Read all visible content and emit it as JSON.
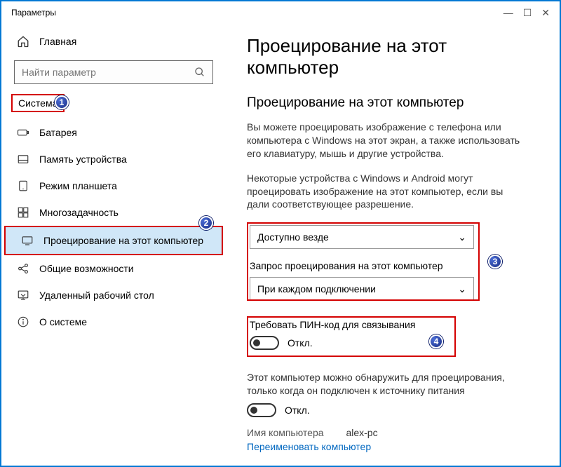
{
  "window": {
    "title": "Параметры"
  },
  "home": {
    "label": "Главная"
  },
  "search": {
    "placeholder": "Найти параметр"
  },
  "section": {
    "label": "Система"
  },
  "nav": [
    {
      "label": "Батарея"
    },
    {
      "label": "Память устройства"
    },
    {
      "label": "Режим планшета"
    },
    {
      "label": "Многозадачность"
    },
    {
      "label": "Проецирование на этот компьютер"
    },
    {
      "label": "Общие возможности"
    },
    {
      "label": "Удаленный рабочий стол"
    },
    {
      "label": "О системе"
    }
  ],
  "main": {
    "title": "Проецирование на этот компьютер",
    "subtitle": "Проецирование на этот компьютер",
    "desc1": "Вы можете проецировать изображение с телефона или компьютера с Windows на этот экран, а также использовать его клавиатуру, мышь и другие устройства.",
    "desc2": "Некоторые устройства с Windows и Android могут проецировать изображение на этот компьютер, если вы дали соответствующее разрешение.",
    "dropdown1": {
      "value": "Доступно везде"
    },
    "dropdown2": {
      "label": "Запрос проецирования на этот компьютер",
      "value": "При каждом подключении"
    },
    "pin": {
      "label": "Требовать ПИН-код для связывания",
      "state": "Откл."
    },
    "power": {
      "label": "Этот компьютер можно обнаружить для проецирования, только когда он подключен к источнику питания",
      "state": "Откл."
    },
    "pcname": {
      "label": "Имя компьютера",
      "value": "alex-pc"
    },
    "rename": "Переименовать компьютер"
  },
  "callouts": [
    "1",
    "2",
    "3",
    "4"
  ]
}
